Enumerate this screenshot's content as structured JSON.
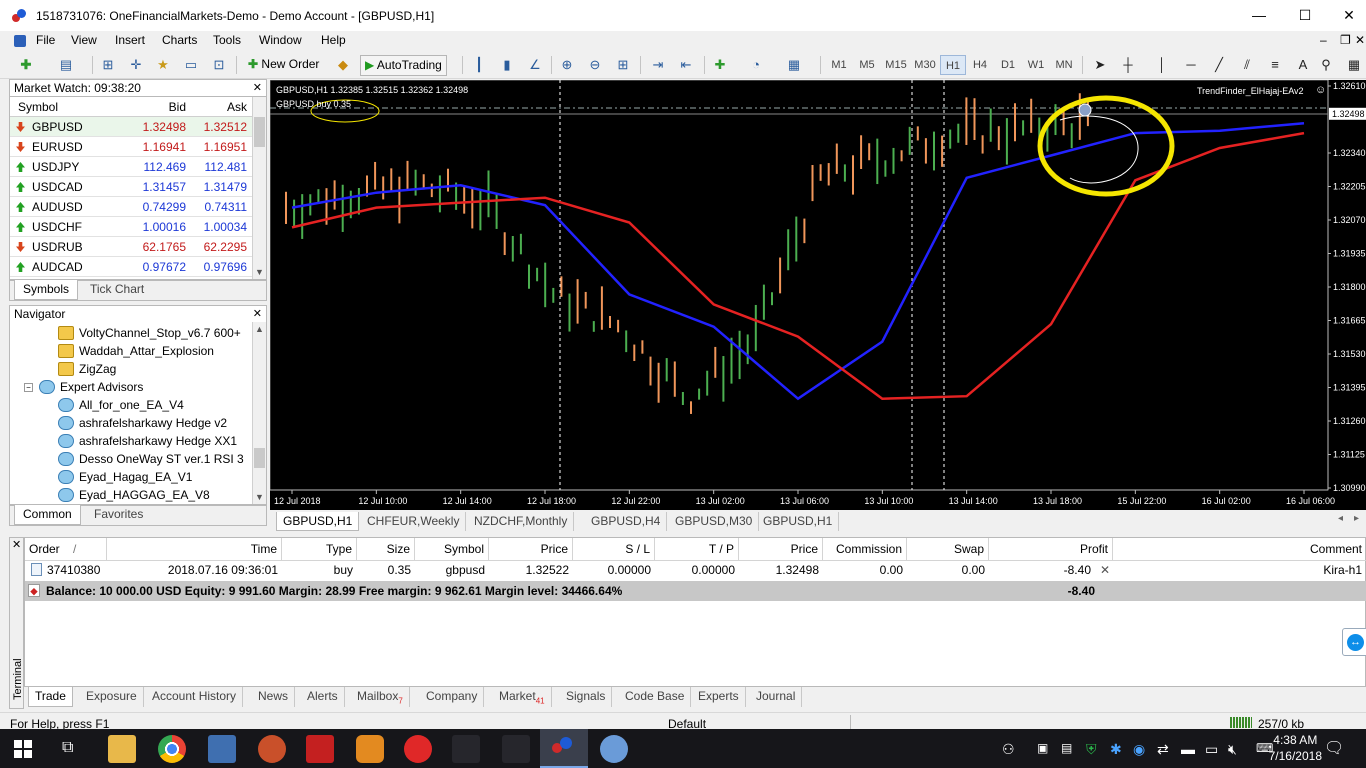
{
  "window": {
    "title": "1518731076: OneFinancialMarkets-Demo - Demo Account - [GBPUSD,H1]",
    "minimize": "—",
    "maximize": "☐",
    "close": "✕"
  },
  "menu": [
    "File",
    "View",
    "Insert",
    "Charts",
    "Tools",
    "Window",
    "Help"
  ],
  "mdi_controls": {
    "minimize": "–",
    "restore": "❐",
    "close": "✕"
  },
  "toolbar": {
    "new_order": "New Order",
    "autotrading": "AutoTrading",
    "timeframes": [
      "M1",
      "M5",
      "M15",
      "M30",
      "H1",
      "H4",
      "D1",
      "W1",
      "MN"
    ],
    "active_timeframe": "H1"
  },
  "market_watch": {
    "title": "Market Watch: 09:38:20",
    "columns": {
      "symbol": "Symbol",
      "bid": "Bid",
      "ask": "Ask"
    },
    "rows": [
      {
        "symbol": "GBPUSD",
        "bid": "1.32498",
        "ask": "1.32512",
        "dir": "down"
      },
      {
        "symbol": "EURUSD",
        "bid": "1.16941",
        "ask": "1.16951",
        "dir": "down"
      },
      {
        "symbol": "USDJPY",
        "bid": "112.469",
        "ask": "112.481",
        "dir": "up"
      },
      {
        "symbol": "USDCAD",
        "bid": "1.31457",
        "ask": "1.31479",
        "dir": "up"
      },
      {
        "symbol": "AUDUSD",
        "bid": "0.74299",
        "ask": "0.74311",
        "dir": "up"
      },
      {
        "symbol": "USDCHF",
        "bid": "1.00016",
        "ask": "1.00034",
        "dir": "up"
      },
      {
        "symbol": "USDRUB",
        "bid": "62.1765",
        "ask": "62.2295",
        "dir": "down"
      },
      {
        "symbol": "AUDCAD",
        "bid": "0.97672",
        "ask": "0.97696",
        "dir": "up"
      }
    ],
    "tabs": [
      "Symbols",
      "Tick Chart"
    ]
  },
  "navigator": {
    "title": "Navigator",
    "items": [
      {
        "label": "VoltyChannel_Stop_v6.7 600+",
        "kind": "indicator",
        "level": 2
      },
      {
        "label": "Waddah_Attar_Explosion",
        "kind": "indicator",
        "level": 2
      },
      {
        "label": "ZigZag",
        "kind": "indicator",
        "level": 2
      },
      {
        "label": "Expert Advisors",
        "kind": "folder",
        "level": 1
      },
      {
        "label": "All_for_one_EA_V4",
        "kind": "ea",
        "level": 2
      },
      {
        "label": "ashrafelsharkawy Hedge v2",
        "kind": "ea",
        "level": 2
      },
      {
        "label": "ashrafelsharkawy Hedge XX1",
        "kind": "ea",
        "level": 2
      },
      {
        "label": "Desso OneWay ST ver.1 RSI 3",
        "kind": "ea",
        "level": 2
      },
      {
        "label": "Eyad_Hagag_EA_V1",
        "kind": "ea",
        "level": 2
      },
      {
        "label": "Eyad_HAGGAG_EA_V8",
        "kind": "ea",
        "level": 2
      }
    ],
    "tabs": [
      "Common",
      "Favorites"
    ]
  },
  "chart": {
    "header": "GBPUSD,H1  1.32385 1.32515 1.32362 1.32498",
    "order_label": "GBPUSD buy 0.35",
    "expert": "TrendFinder_ElHajaj-EAv2",
    "price_labels": [
      "1.32610",
      "1.32498",
      "1.32340",
      "1.32205",
      "1.32070",
      "1.31935",
      "1.31800",
      "1.31665",
      "1.31530",
      "1.31395",
      "1.31260",
      "1.31125",
      "1.30990"
    ],
    "time_labels": [
      "12 Jul 2018",
      "12 Jul 10:00",
      "12 Jul 14:00",
      "12 Jul 18:00",
      "12 Jul 22:00",
      "13 Jul 02:00",
      "13 Jul 06:00",
      "13 Jul 10:00",
      "13 Jul 14:00",
      "13 Jul 18:00",
      "15 Jul 22:00",
      "16 Jul 02:00",
      "16 Jul 06:00"
    ],
    "colors": {
      "bull": "#4caf50",
      "bear": "#f0965a",
      "fast": "#2222ff",
      "slow": "#e52222",
      "highlight": "#f5e600",
      "background": "#000000"
    }
  },
  "chart_data": {
    "type": "line",
    "title": "GBPUSD,H1",
    "x": [
      "12 Jul 2018",
      "12 Jul 10:00",
      "12 Jul 14:00",
      "12 Jul 18:00",
      "12 Jul 22:00",
      "13 Jul 02:00",
      "13 Jul 06:00",
      "13 Jul 10:00",
      "13 Jul 14:00",
      "13 Jul 18:00",
      "15 Jul 22:00",
      "16 Jul 02:00",
      "16 Jul 06:00"
    ],
    "ylim": [
      1.3099,
      1.3261
    ],
    "series": [
      {
        "values": [
          1.3212,
          1.3218,
          1.3221,
          1.3213,
          1.3177,
          1.3164,
          1.3135,
          1.3158,
          1.3224,
          1.3233,
          1.3242,
          1.3243,
          1.3246
        ]
      },
      {
        "values": [
          1.3204,
          1.3212,
          1.3214,
          1.3216,
          1.3206,
          1.3173,
          1.316,
          1.3135,
          1.3136,
          1.3165,
          1.3223,
          1.3236,
          1.3242
        ]
      }
    ]
  },
  "chart_tabs": [
    "GBPUSD,H1",
    "CHFEUR,Weekly",
    "NZDCHF,Monthly",
    "GBPUSD,H4",
    "GBPUSD,M30",
    "GBPUSD,H1"
  ],
  "terminal": {
    "columns": [
      "Order",
      "/",
      "Time",
      "Type",
      "Size",
      "Symbol",
      "Price",
      "S / L",
      "T / P",
      "Price",
      "Commission",
      "Swap",
      "Profit",
      "Comment"
    ],
    "order": {
      "id": "37410380",
      "time": "2018.07.16 09:36:01",
      "type": "buy",
      "size": "0.35",
      "symbol": "gbpusd",
      "open_price": "1.32522",
      "sl": "0.00000",
      "tp": "0.00000",
      "price": "1.32498",
      "commission": "0.00",
      "swap": "0.00",
      "profit": "-8.40",
      "comment": "Kira-h1"
    },
    "balance_line": "Balance: 10 000.00 USD  Equity: 9 991.60  Margin: 28.99  Free margin: 9 962.61  Margin level: 34466.64%",
    "balance_profit": "-8.40",
    "side_label": "Terminal",
    "tabs": [
      "Trade",
      "Exposure",
      "Account History",
      "News",
      "Alerts",
      "Mailbox",
      "Company",
      "Market",
      "Signals",
      "Code Base",
      "Experts",
      "Journal"
    ],
    "mailbox_count": "7",
    "market_count": "41"
  },
  "status": {
    "help": "For Help, press F1",
    "profile": "Default",
    "traffic": "257/0 kb"
  },
  "taskbar": {
    "time": "4:38 AM",
    "date": "7/16/2018"
  }
}
